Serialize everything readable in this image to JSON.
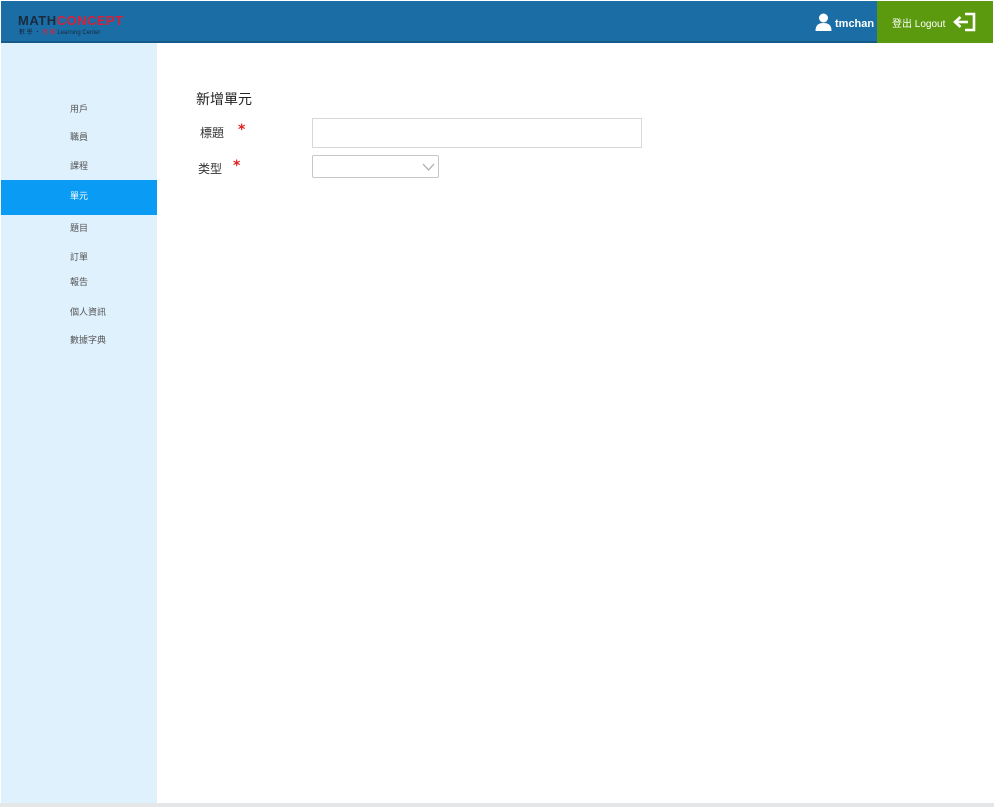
{
  "app": {
    "logo": {
      "main_part1": "MATH",
      "main_part2": "CONCEPT",
      "sub_part1": "數 學 ‧ ",
      "sub_part2": "思 維",
      "sub_part3": " Learning Center"
    },
    "user": {
      "name": "tmchan",
      "icon": "user-icon"
    },
    "logout": {
      "label": "登出 Logout",
      "icon": "logout-icon"
    }
  },
  "sidebar": {
    "items": [
      {
        "label": "用戶",
        "active": false
      },
      {
        "label": "職員",
        "active": false
      },
      {
        "label": "課程",
        "active": false
      },
      {
        "label": "單元",
        "active": true
      },
      {
        "label": "題目",
        "active": false
      },
      {
        "label": "訂單",
        "active": false
      },
      {
        "label": "報告",
        "active": false
      },
      {
        "label": "個人資訊",
        "active": false
      },
      {
        "label": "數據字典",
        "active": false
      }
    ]
  },
  "form": {
    "title": "新增單元",
    "fields": [
      {
        "label": "標題",
        "required_mark": "*",
        "value": "",
        "placeholder": ""
      },
      {
        "label": "类型",
        "required_mark": "*",
        "selected": ""
      }
    ]
  },
  "colors": {
    "header": "#1a6ea5",
    "logout": "#5b9a0e",
    "sidebar": "#dff1fd",
    "active_item": "#0a9cf5",
    "required": "#e02020"
  }
}
